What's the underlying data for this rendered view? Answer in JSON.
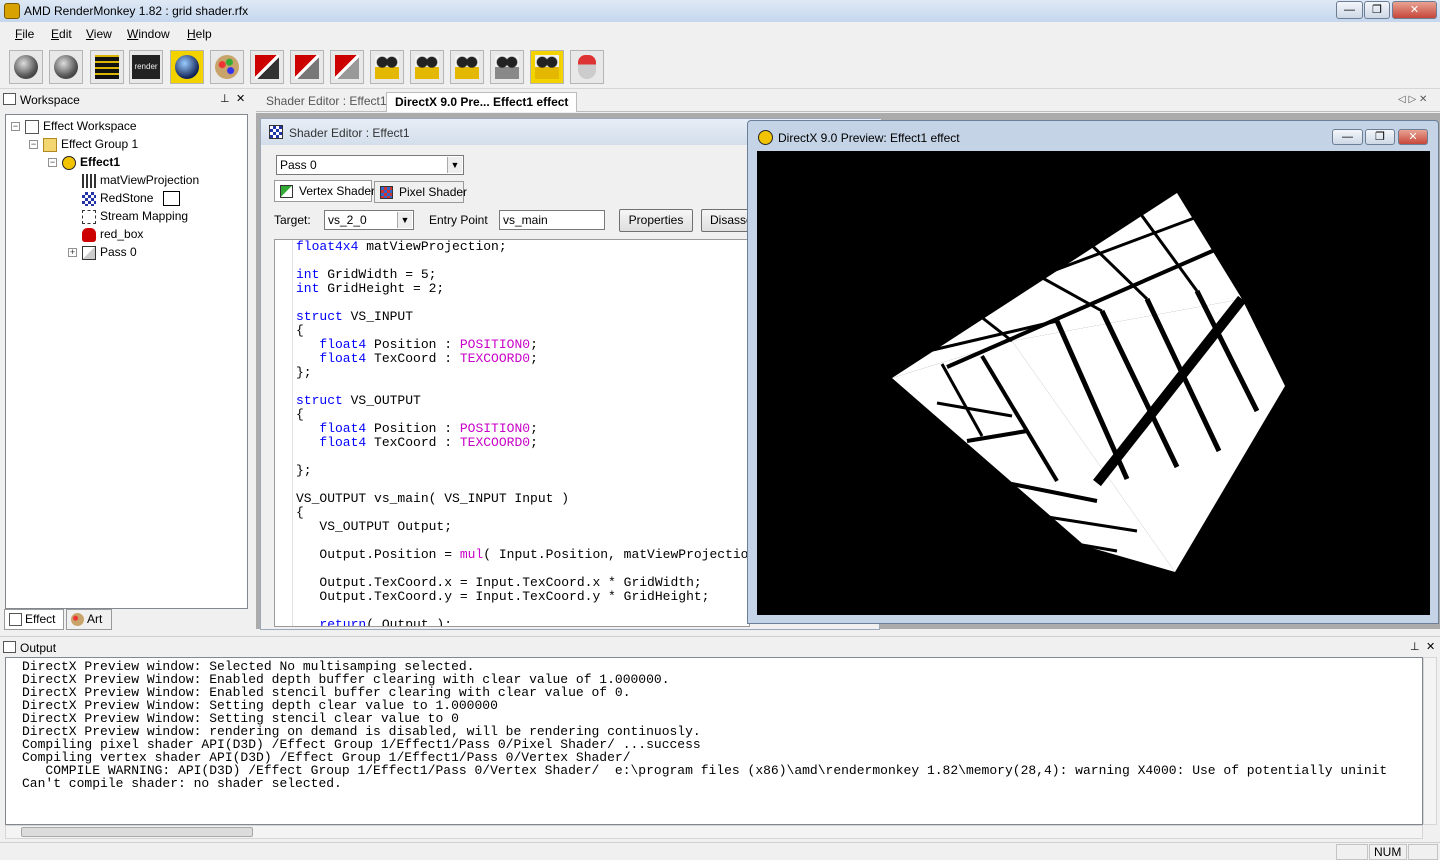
{
  "window": {
    "title": "AMD RenderMonkey 1.82 : grid shader.rfx",
    "min_label": "—",
    "max_label": "❐",
    "close_label": "✕"
  },
  "menu": [
    "File",
    "Edit",
    "View",
    "Window",
    "Help"
  ],
  "toolbar": {
    "tools": [
      {
        "icon": "add-effect-icon"
      },
      {
        "icon": "add-effect-workspace-icon"
      },
      {
        "icon": "editor-icon"
      },
      {
        "icon": "render-icon",
        "text": "render"
      },
      {
        "icon": "sphere-icon"
      },
      {
        "icon": "art-palette-icon"
      },
      {
        "icon": "node-icon-1"
      },
      {
        "icon": "node-icon-2"
      },
      {
        "icon": "node-icon-3"
      },
      {
        "icon": "camera-icon-1"
      },
      {
        "icon": "camera-icon-2"
      },
      {
        "icon": "camera-icon-3"
      },
      {
        "icon": "camera-icon-4"
      },
      {
        "icon": "camera-icon-5"
      },
      {
        "icon": "mouse-icon"
      }
    ]
  },
  "workspace": {
    "title": "Workspace",
    "pin": "⊥",
    "close": "✕",
    "tree": {
      "root": "Effect Workspace",
      "group": "Effect Group 1",
      "effect": "Effect1",
      "items": [
        "matViewProjection",
        "RedStone",
        "Stream Mapping",
        "red_box",
        "Pass 0"
      ]
    },
    "tabs": [
      "Effect",
      "Art"
    ]
  },
  "doc_tabs": {
    "tab1": "Shader Editor : Effect1",
    "tab2": "DirectX 9.0 Pre... Effect1 effect",
    "nav": "◁ ▷ ✕"
  },
  "shader_editor": {
    "title": "Shader Editor : Effect1",
    "pass_select": "Pass 0",
    "tab_vertex": "Vertex Shader",
    "tab_pixel": "Pixel Shader",
    "target_label": "Target:",
    "target_value": "vs_2_0",
    "entry_label": "Entry Point",
    "entry_value": "vs_main",
    "properties_button": "Properties",
    "disassemble_button": "Disasse"
  },
  "code_lines": [
    [
      {
        "t": "float4x4",
        "c": "kw"
      },
      {
        "t": " matViewProjection;"
      }
    ],
    [],
    [
      {
        "t": "int",
        "c": "kw"
      },
      {
        "t": " GridWidth = 5;"
      }
    ],
    [
      {
        "t": "int",
        "c": "kw"
      },
      {
        "t": " GridHeight = 2;"
      }
    ],
    [],
    [
      {
        "t": "struct",
        "c": "kw"
      },
      {
        "t": " VS_INPUT"
      }
    ],
    [
      {
        "t": "{"
      }
    ],
    [
      {
        "t": "   "
      },
      {
        "t": "float4",
        "c": "kw"
      },
      {
        "t": " Position : "
      },
      {
        "t": "POSITION0",
        "c": "sem"
      },
      {
        "t": ";"
      }
    ],
    [
      {
        "t": "   "
      },
      {
        "t": "float4",
        "c": "kw"
      },
      {
        "t": " TexCoord : "
      },
      {
        "t": "TEXCOORD0",
        "c": "sem"
      },
      {
        "t": ";"
      }
    ],
    [
      {
        "t": "};"
      }
    ],
    [],
    [
      {
        "t": "struct",
        "c": "kw"
      },
      {
        "t": " VS_OUTPUT"
      }
    ],
    [
      {
        "t": "{"
      }
    ],
    [
      {
        "t": "   "
      },
      {
        "t": "float4",
        "c": "kw"
      },
      {
        "t": " Position : "
      },
      {
        "t": "POSITION0",
        "c": "sem"
      },
      {
        "t": ";"
      }
    ],
    [
      {
        "t": "   "
      },
      {
        "t": "float4",
        "c": "kw"
      },
      {
        "t": " TexCoord : "
      },
      {
        "t": "TEXCOORD0",
        "c": "sem"
      },
      {
        "t": ";"
      }
    ],
    [],
    [
      {
        "t": "};"
      }
    ],
    [],
    [
      {
        "t": "VS_OUTPUT vs_main( VS_INPUT Input )"
      }
    ],
    [
      {
        "t": "{"
      }
    ],
    [
      {
        "t": "   VS_OUTPUT Output;"
      }
    ],
    [],
    [
      {
        "t": "   Output.Position = "
      },
      {
        "t": "mul",
        "c": "sem"
      },
      {
        "t": "( Input.Position, matViewProjection );"
      }
    ],
    [],
    [
      {
        "t": "   Output.TexCoord.x = Input.TexCoord.x * GridWidth;"
      }
    ],
    [
      {
        "t": "   Output.TexCoord.y = Input.TexCoord.y * GridHeight;"
      }
    ],
    [],
    [
      {
        "t": "   "
      },
      {
        "t": "return",
        "c": "kw"
      },
      {
        "t": "( Output );"
      }
    ]
  ],
  "preview": {
    "title": "DirectX 9.0 Preview: Effect1 effect",
    "min_label": "—",
    "max_label": "❐",
    "close_label": "✕"
  },
  "output": {
    "title": "Output",
    "pin": "⊥",
    "close": "✕",
    "lines": [
      "DirectX Preview window: Selected No multisamping selected.",
      "DirectX Preview Window: Enabled depth buffer clearing with clear value of 1.000000.",
      "DirectX Preview Window: Enabled stencil buffer clearing with clear value of 0.",
      "DirectX Preview Window: Setting depth clear value to 1.000000",
      "DirectX Preview Window: Setting stencil clear value to 0",
      "DirectX Preview window: rendering on demand is disabled, will be rendering continuosly.",
      "Compiling pixel shader API(D3D) /Effect Group 1/Effect1/Pass 0/Pixel Shader/ ...success",
      "Compiling vertex shader API(D3D) /Effect Group 1/Effect1/Pass 0/Vertex Shader/",
      "   COMPILE WARNING: API(D3D) /Effect Group 1/Effect1/Pass 0/Vertex Shader/  e:\\program files (x86)\\amd\\rendermonkey 1.82\\memory(28,4): warning X4000: Use of potentially uninit",
      "Can't compile shader: no shader selected."
    ]
  },
  "status": {
    "num": "NUM"
  },
  "colors": {
    "keyword": "#0000ff",
    "semantic": "#c800c8",
    "preview_bg": "#000000",
    "cube_face": "#ffffff"
  }
}
